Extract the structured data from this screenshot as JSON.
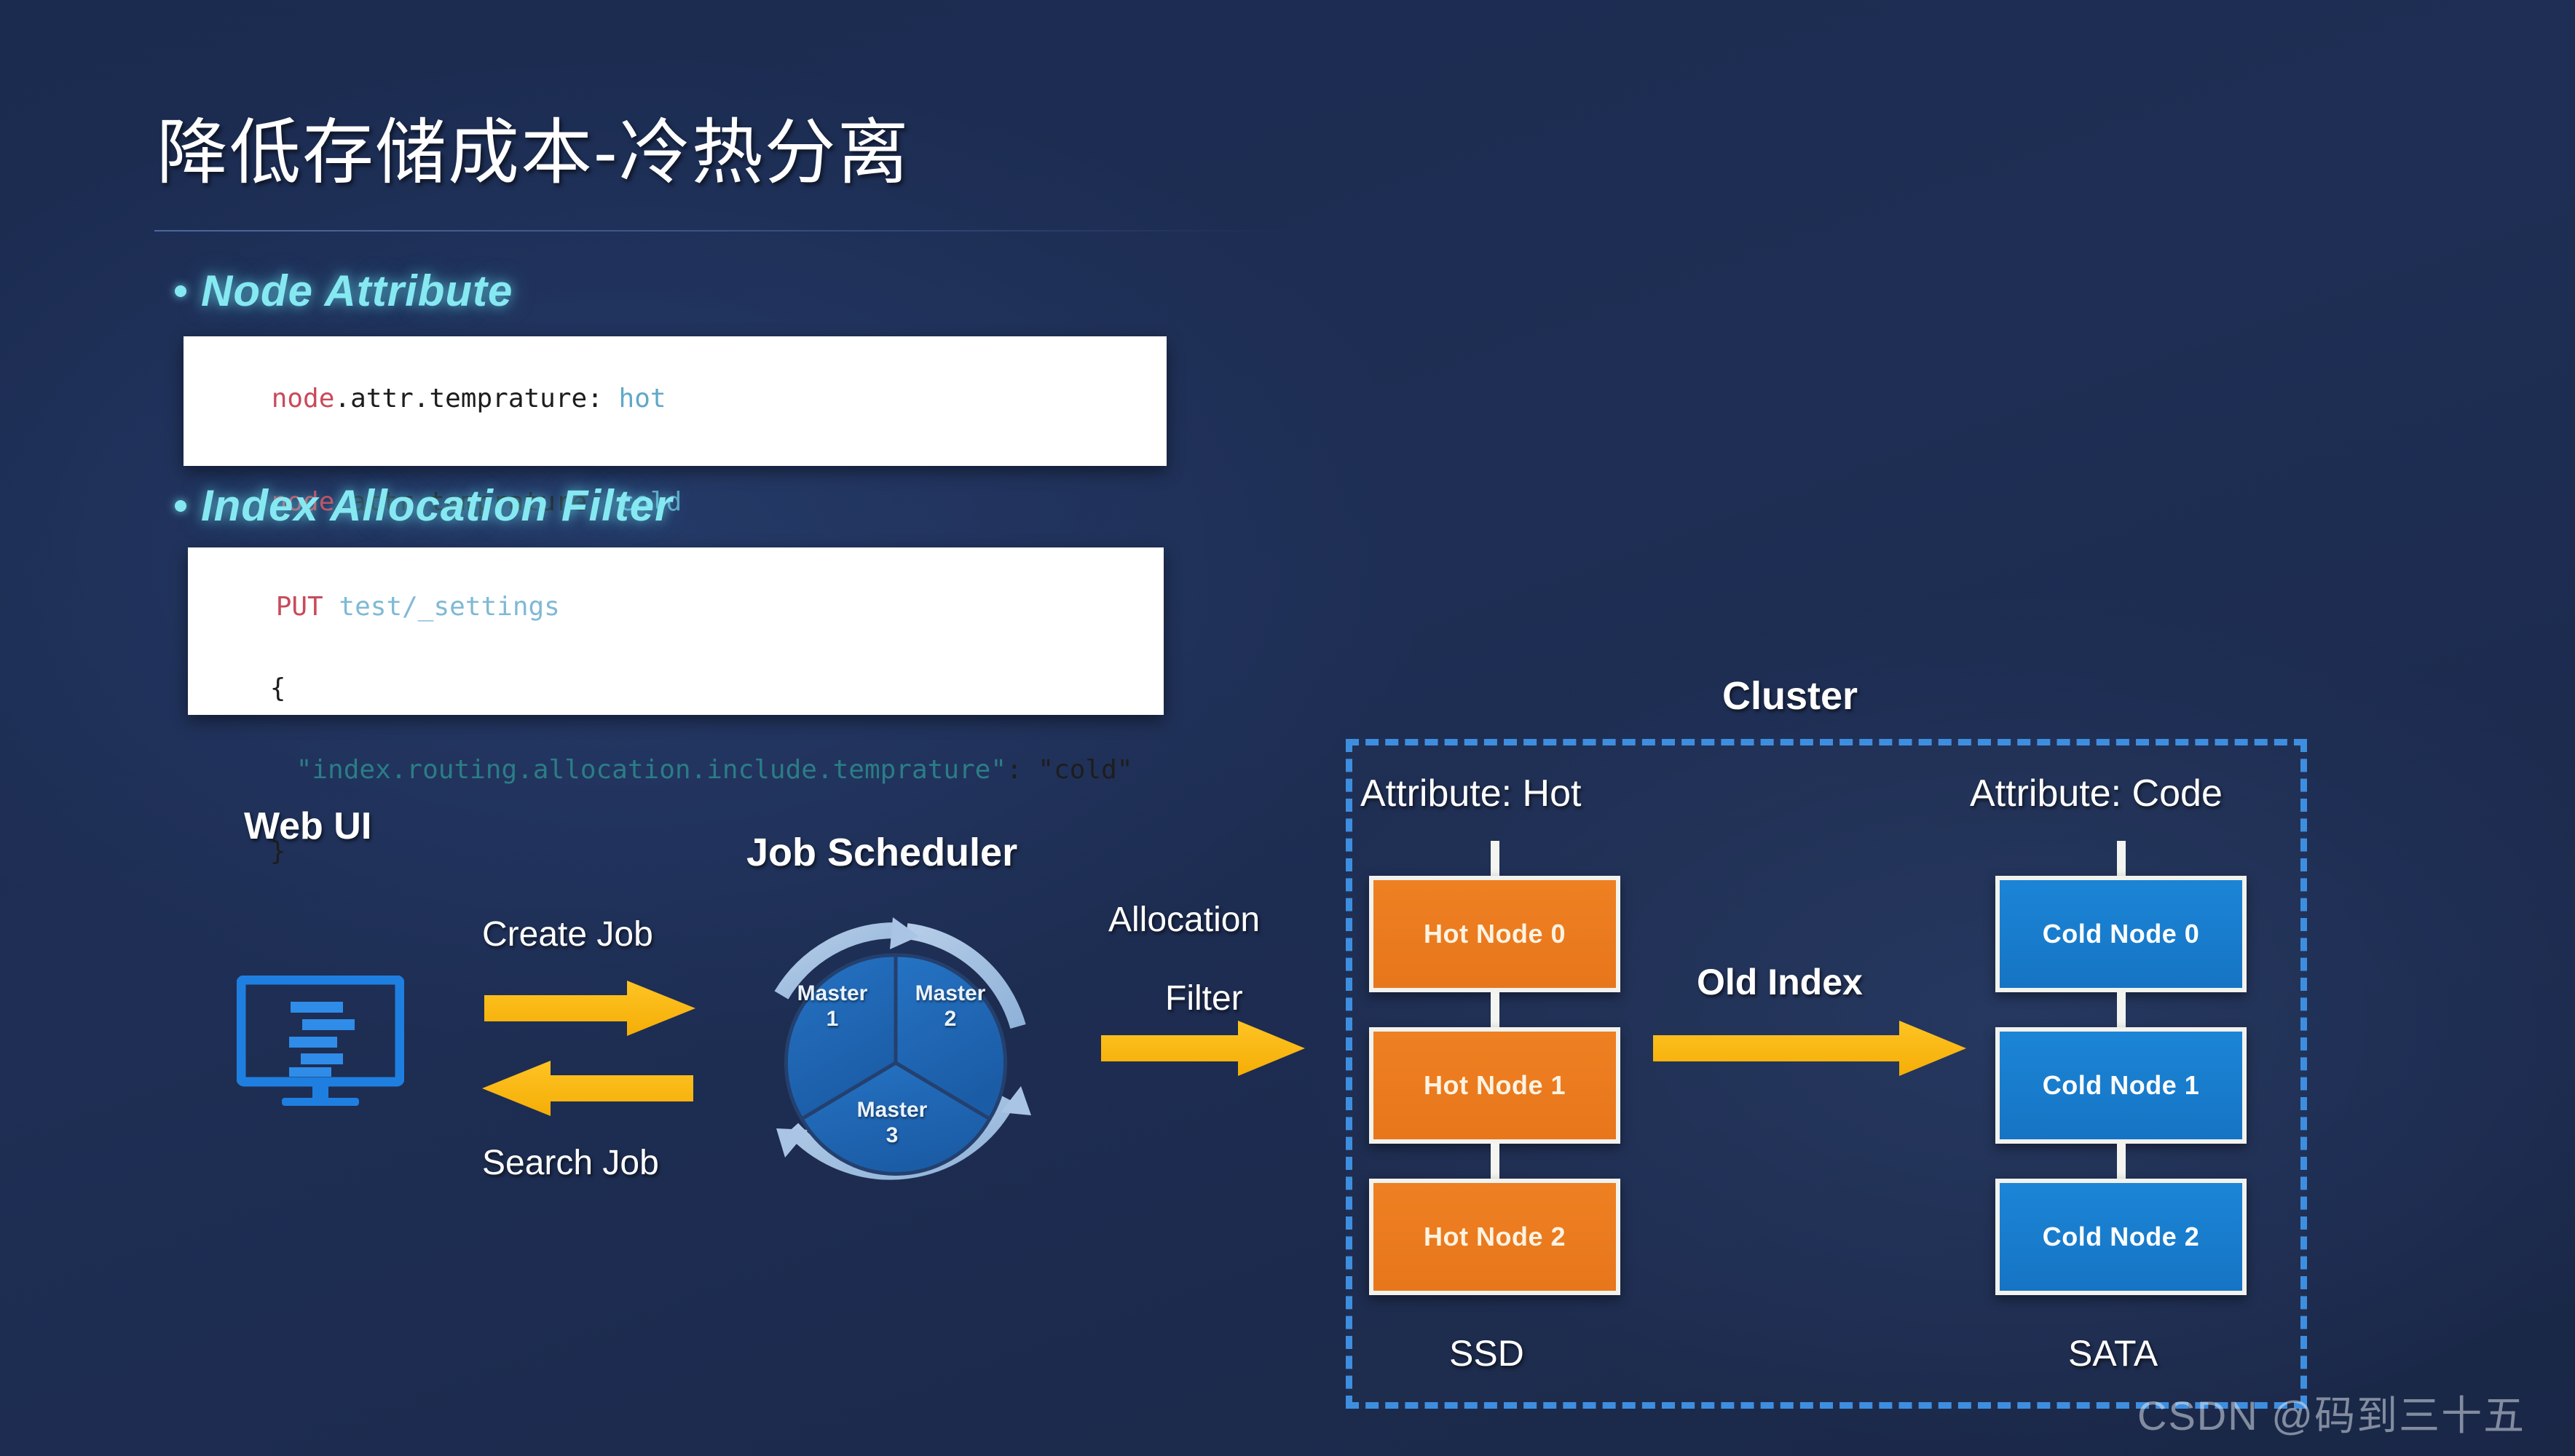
{
  "slide": {
    "title": "降低存储成本-冷热分离",
    "watermark": "CSDN @码到三十五"
  },
  "sections": [
    {
      "heading": "Node Attribute"
    },
    {
      "heading": "Index Allocation Filter"
    }
  ],
  "code_blocks": {
    "node_attribute": {
      "lines": [
        {
          "key": "node",
          "rest": ".attr.temprature: ",
          "value": "hot"
        },
        {
          "key": "node",
          "rest": ".attr.temprature: ",
          "value": "cold"
        }
      ]
    },
    "index_allocation_filter": {
      "method": "PUT",
      "path": "test/_settings",
      "open_brace": "{",
      "body_key": "\"index.routing.allocation.include.temprature\"",
      "body_sep": ": ",
      "body_value": "\"cold\"",
      "close_brace": "}"
    }
  },
  "diagram": {
    "web_ui_label": "Web UI",
    "job_scheduler_label": "Job Scheduler",
    "cluster_label": "Cluster",
    "masters": [
      {
        "name": "Master",
        "num": "1"
      },
      {
        "name": "Master",
        "num": "2"
      },
      {
        "name": "Master",
        "num": "3"
      }
    ],
    "flows": {
      "create_job": "Create Job",
      "search_job": "Search Job",
      "allocation": "Allocation",
      "filter": "Filter",
      "old_index": "Old Index"
    },
    "hot_group": {
      "attribute_label": "Attribute: Hot",
      "storage_label": "SSD",
      "nodes": [
        "Hot Node 0",
        "Hot Node 1",
        "Hot Node 2"
      ]
    },
    "cold_group": {
      "attribute_label": "Attribute: Code",
      "storage_label": "SATA",
      "nodes": [
        "Cold Node 0",
        "Cold Node 1",
        "Cold Node 2"
      ]
    }
  },
  "colors": {
    "background": "#1e2d52",
    "heading_cyan": "#86e9f2",
    "arrow_yellow": "#fbbc11",
    "hot_node": "#ee8022",
    "cold_node": "#1c85d6",
    "cluster_border": "#3e8ee0",
    "code_key_red": "#c94a5b",
    "code_value_blue": "#5fa8c8",
    "code_string_teal": "#2b7d86"
  }
}
